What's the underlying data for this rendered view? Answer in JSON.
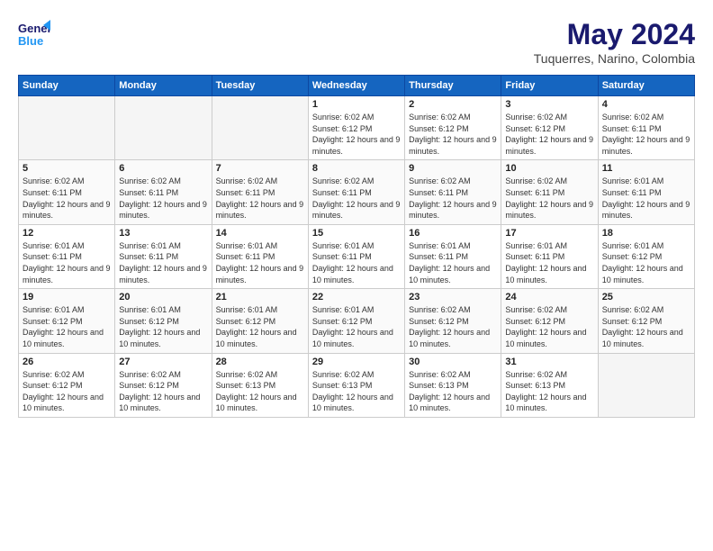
{
  "header": {
    "logo_general": "General",
    "logo_blue": "Blue",
    "month_year": "May 2024",
    "location": "Tuquerres, Narino, Colombia"
  },
  "weekdays": [
    "Sunday",
    "Monday",
    "Tuesday",
    "Wednesday",
    "Thursday",
    "Friday",
    "Saturday"
  ],
  "weeks": [
    [
      {
        "day": "",
        "empty": true
      },
      {
        "day": "",
        "empty": true
      },
      {
        "day": "",
        "empty": true
      },
      {
        "day": "1",
        "sunrise": "6:02 AM",
        "sunset": "6:12 PM",
        "daylight": "12 hours and 9 minutes."
      },
      {
        "day": "2",
        "sunrise": "6:02 AM",
        "sunset": "6:12 PM",
        "daylight": "12 hours and 9 minutes."
      },
      {
        "day": "3",
        "sunrise": "6:02 AM",
        "sunset": "6:12 PM",
        "daylight": "12 hours and 9 minutes."
      },
      {
        "day": "4",
        "sunrise": "6:02 AM",
        "sunset": "6:11 PM",
        "daylight": "12 hours and 9 minutes."
      }
    ],
    [
      {
        "day": "5",
        "sunrise": "6:02 AM",
        "sunset": "6:11 PM",
        "daylight": "12 hours and 9 minutes."
      },
      {
        "day": "6",
        "sunrise": "6:02 AM",
        "sunset": "6:11 PM",
        "daylight": "12 hours and 9 minutes."
      },
      {
        "day": "7",
        "sunrise": "6:02 AM",
        "sunset": "6:11 PM",
        "daylight": "12 hours and 9 minutes."
      },
      {
        "day": "8",
        "sunrise": "6:02 AM",
        "sunset": "6:11 PM",
        "daylight": "12 hours and 9 minutes."
      },
      {
        "day": "9",
        "sunrise": "6:02 AM",
        "sunset": "6:11 PM",
        "daylight": "12 hours and 9 minutes."
      },
      {
        "day": "10",
        "sunrise": "6:02 AM",
        "sunset": "6:11 PM",
        "daylight": "12 hours and 9 minutes."
      },
      {
        "day": "11",
        "sunrise": "6:01 AM",
        "sunset": "6:11 PM",
        "daylight": "12 hours and 9 minutes."
      }
    ],
    [
      {
        "day": "12",
        "sunrise": "6:01 AM",
        "sunset": "6:11 PM",
        "daylight": "12 hours and 9 minutes."
      },
      {
        "day": "13",
        "sunrise": "6:01 AM",
        "sunset": "6:11 PM",
        "daylight": "12 hours and 9 minutes."
      },
      {
        "day": "14",
        "sunrise": "6:01 AM",
        "sunset": "6:11 PM",
        "daylight": "12 hours and 9 minutes."
      },
      {
        "day": "15",
        "sunrise": "6:01 AM",
        "sunset": "6:11 PM",
        "daylight": "12 hours and 10 minutes."
      },
      {
        "day": "16",
        "sunrise": "6:01 AM",
        "sunset": "6:11 PM",
        "daylight": "12 hours and 10 minutes."
      },
      {
        "day": "17",
        "sunrise": "6:01 AM",
        "sunset": "6:11 PM",
        "daylight": "12 hours and 10 minutes."
      },
      {
        "day": "18",
        "sunrise": "6:01 AM",
        "sunset": "6:12 PM",
        "daylight": "12 hours and 10 minutes."
      }
    ],
    [
      {
        "day": "19",
        "sunrise": "6:01 AM",
        "sunset": "6:12 PM",
        "daylight": "12 hours and 10 minutes."
      },
      {
        "day": "20",
        "sunrise": "6:01 AM",
        "sunset": "6:12 PM",
        "daylight": "12 hours and 10 minutes."
      },
      {
        "day": "21",
        "sunrise": "6:01 AM",
        "sunset": "6:12 PM",
        "daylight": "12 hours and 10 minutes."
      },
      {
        "day": "22",
        "sunrise": "6:01 AM",
        "sunset": "6:12 PM",
        "daylight": "12 hours and 10 minutes."
      },
      {
        "day": "23",
        "sunrise": "6:02 AM",
        "sunset": "6:12 PM",
        "daylight": "12 hours and 10 minutes."
      },
      {
        "day": "24",
        "sunrise": "6:02 AM",
        "sunset": "6:12 PM",
        "daylight": "12 hours and 10 minutes."
      },
      {
        "day": "25",
        "sunrise": "6:02 AM",
        "sunset": "6:12 PM",
        "daylight": "12 hours and 10 minutes."
      }
    ],
    [
      {
        "day": "26",
        "sunrise": "6:02 AM",
        "sunset": "6:12 PM",
        "daylight": "12 hours and 10 minutes."
      },
      {
        "day": "27",
        "sunrise": "6:02 AM",
        "sunset": "6:12 PM",
        "daylight": "12 hours and 10 minutes."
      },
      {
        "day": "28",
        "sunrise": "6:02 AM",
        "sunset": "6:13 PM",
        "daylight": "12 hours and 10 minutes."
      },
      {
        "day": "29",
        "sunrise": "6:02 AM",
        "sunset": "6:13 PM",
        "daylight": "12 hours and 10 minutes."
      },
      {
        "day": "30",
        "sunrise": "6:02 AM",
        "sunset": "6:13 PM",
        "daylight": "12 hours and 10 minutes."
      },
      {
        "day": "31",
        "sunrise": "6:02 AM",
        "sunset": "6:13 PM",
        "daylight": "12 hours and 10 minutes."
      },
      {
        "day": "",
        "empty": true
      }
    ]
  ],
  "labels": {
    "sunrise": "Sunrise:",
    "sunset": "Sunset:",
    "daylight": "Daylight:"
  }
}
